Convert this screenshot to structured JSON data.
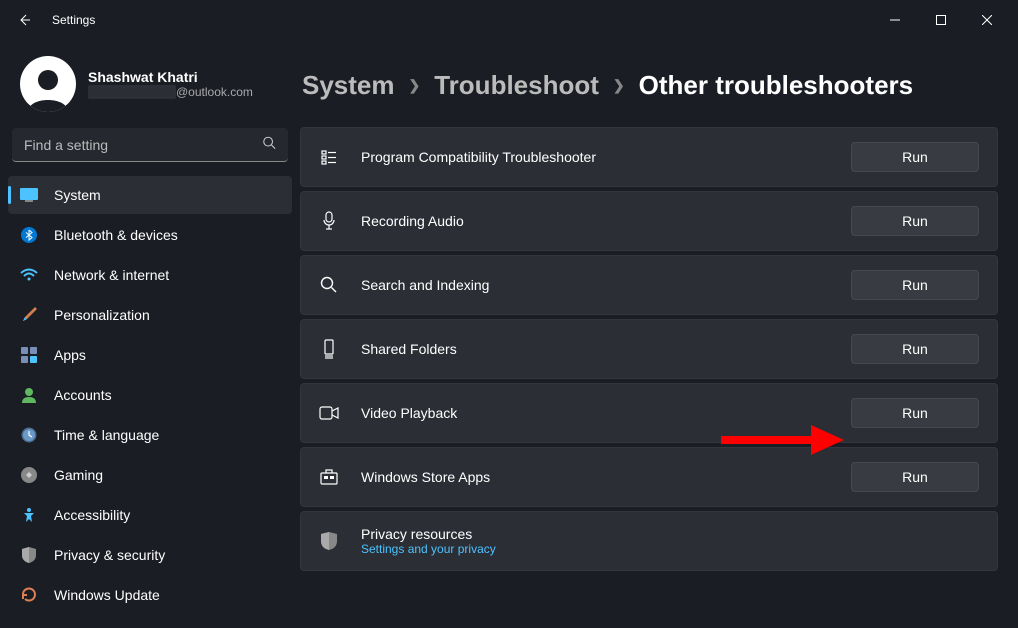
{
  "app_title": "Settings",
  "profile": {
    "name": "Shashwat Khatri",
    "email_domain": "@outlook.com"
  },
  "search": {
    "placeholder": "Find a setting"
  },
  "nav": [
    {
      "label": "System",
      "icon": "system"
    },
    {
      "label": "Bluetooth & devices",
      "icon": "bluetooth"
    },
    {
      "label": "Network & internet",
      "icon": "wifi"
    },
    {
      "label": "Personalization",
      "icon": "brush"
    },
    {
      "label": "Apps",
      "icon": "apps"
    },
    {
      "label": "Accounts",
      "icon": "account"
    },
    {
      "label": "Time & language",
      "icon": "clock"
    },
    {
      "label": "Gaming",
      "icon": "gaming"
    },
    {
      "label": "Accessibility",
      "icon": "accessibility"
    },
    {
      "label": "Privacy & security",
      "icon": "shield"
    },
    {
      "label": "Windows Update",
      "icon": "update"
    }
  ],
  "breadcrumb": {
    "l1": "System",
    "l2": "Troubleshoot",
    "l3": "Other troubleshooters"
  },
  "run_label": "Run",
  "troubleshooters": [
    {
      "label": "Program Compatibility Troubleshooter",
      "icon": "compat"
    },
    {
      "label": "Recording Audio",
      "icon": "mic"
    },
    {
      "label": "Search and Indexing",
      "icon": "search"
    },
    {
      "label": "Shared Folders",
      "icon": "folder"
    },
    {
      "label": "Video Playback",
      "icon": "video"
    },
    {
      "label": "Windows Store Apps",
      "icon": "store"
    }
  ],
  "privacy_card": {
    "title": "Privacy resources",
    "link": "Settings and your privacy"
  }
}
